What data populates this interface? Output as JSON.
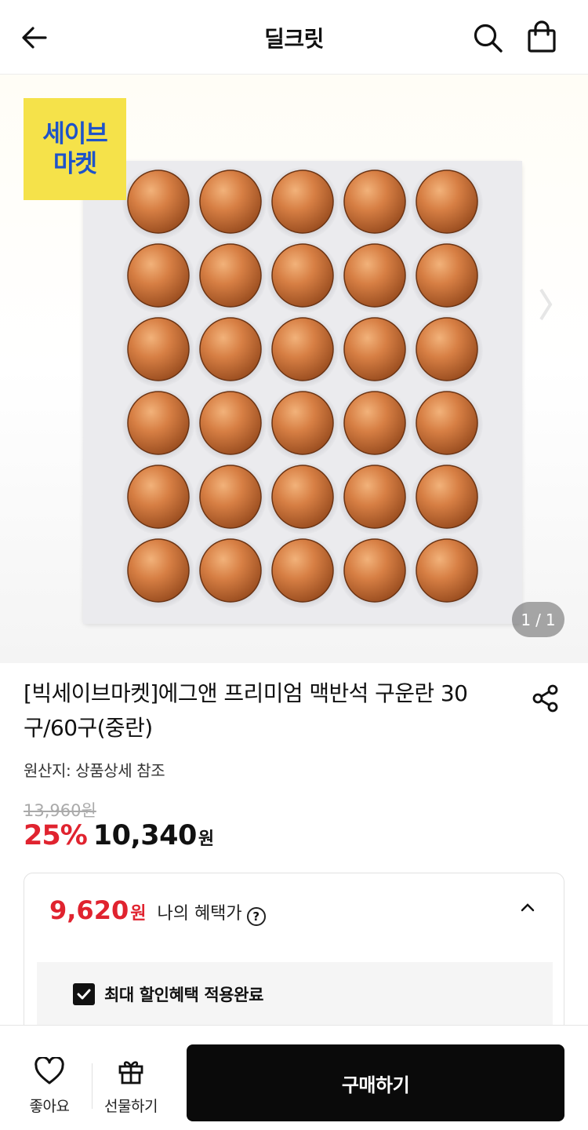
{
  "header": {
    "title": "딜크릿",
    "back_icon": "arrow-left-icon",
    "search_icon": "search-icon",
    "cart_icon": "shopping-bag-icon"
  },
  "hero": {
    "badge_line1": "세이브",
    "badge_line2": "마켓",
    "counter_current": "1",
    "counter_sep": "/",
    "counter_total": "1"
  },
  "product": {
    "title": "[빅세이브마켓]에그앤 프리미엄 맥반석 구운란 30구/60구(중란)",
    "origin": "원산지: 상품상세 참조",
    "original_price": "13,960원",
    "discount": "25%",
    "price": "10,340",
    "currency": "원"
  },
  "benefit": {
    "price": "9,620",
    "currency": "원",
    "label": "나의 혜택가",
    "help": "?",
    "check_label": "최대 할인혜택 적용완료"
  },
  "bottom": {
    "like_label": "좋아요",
    "gift_label": "선물하기",
    "buy_label": "구매하기"
  },
  "colors": {
    "accent_red": "#e0232f",
    "badge_yellow": "#f5e24a",
    "badge_blue": "#1e53c9",
    "buy_button": "#0a0a0a"
  }
}
